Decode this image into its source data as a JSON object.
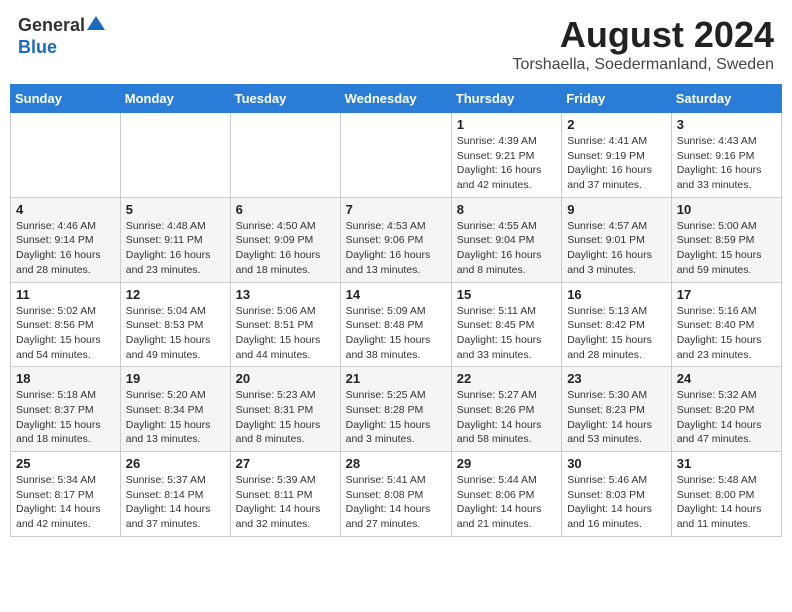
{
  "header": {
    "logo_general": "General",
    "logo_blue": "Blue",
    "title": "August 2024",
    "location": "Torshaella, Soedermanland, Sweden"
  },
  "days_of_week": [
    "Sunday",
    "Monday",
    "Tuesday",
    "Wednesday",
    "Thursday",
    "Friday",
    "Saturday"
  ],
  "weeks": [
    [
      {
        "day": "",
        "info": ""
      },
      {
        "day": "",
        "info": ""
      },
      {
        "day": "",
        "info": ""
      },
      {
        "day": "",
        "info": ""
      },
      {
        "day": "1",
        "info": "Sunrise: 4:39 AM\nSunset: 9:21 PM\nDaylight: 16 hours\nand 42 minutes."
      },
      {
        "day": "2",
        "info": "Sunrise: 4:41 AM\nSunset: 9:19 PM\nDaylight: 16 hours\nand 37 minutes."
      },
      {
        "day": "3",
        "info": "Sunrise: 4:43 AM\nSunset: 9:16 PM\nDaylight: 16 hours\nand 33 minutes."
      }
    ],
    [
      {
        "day": "4",
        "info": "Sunrise: 4:46 AM\nSunset: 9:14 PM\nDaylight: 16 hours\nand 28 minutes."
      },
      {
        "day": "5",
        "info": "Sunrise: 4:48 AM\nSunset: 9:11 PM\nDaylight: 16 hours\nand 23 minutes."
      },
      {
        "day": "6",
        "info": "Sunrise: 4:50 AM\nSunset: 9:09 PM\nDaylight: 16 hours\nand 18 minutes."
      },
      {
        "day": "7",
        "info": "Sunrise: 4:53 AM\nSunset: 9:06 PM\nDaylight: 16 hours\nand 13 minutes."
      },
      {
        "day": "8",
        "info": "Sunrise: 4:55 AM\nSunset: 9:04 PM\nDaylight: 16 hours\nand 8 minutes."
      },
      {
        "day": "9",
        "info": "Sunrise: 4:57 AM\nSunset: 9:01 PM\nDaylight: 16 hours\nand 3 minutes."
      },
      {
        "day": "10",
        "info": "Sunrise: 5:00 AM\nSunset: 8:59 PM\nDaylight: 15 hours\nand 59 minutes."
      }
    ],
    [
      {
        "day": "11",
        "info": "Sunrise: 5:02 AM\nSunset: 8:56 PM\nDaylight: 15 hours\nand 54 minutes."
      },
      {
        "day": "12",
        "info": "Sunrise: 5:04 AM\nSunset: 8:53 PM\nDaylight: 15 hours\nand 49 minutes."
      },
      {
        "day": "13",
        "info": "Sunrise: 5:06 AM\nSunset: 8:51 PM\nDaylight: 15 hours\nand 44 minutes."
      },
      {
        "day": "14",
        "info": "Sunrise: 5:09 AM\nSunset: 8:48 PM\nDaylight: 15 hours\nand 38 minutes."
      },
      {
        "day": "15",
        "info": "Sunrise: 5:11 AM\nSunset: 8:45 PM\nDaylight: 15 hours\nand 33 minutes."
      },
      {
        "day": "16",
        "info": "Sunrise: 5:13 AM\nSunset: 8:42 PM\nDaylight: 15 hours\nand 28 minutes."
      },
      {
        "day": "17",
        "info": "Sunrise: 5:16 AM\nSunset: 8:40 PM\nDaylight: 15 hours\nand 23 minutes."
      }
    ],
    [
      {
        "day": "18",
        "info": "Sunrise: 5:18 AM\nSunset: 8:37 PM\nDaylight: 15 hours\nand 18 minutes."
      },
      {
        "day": "19",
        "info": "Sunrise: 5:20 AM\nSunset: 8:34 PM\nDaylight: 15 hours\nand 13 minutes."
      },
      {
        "day": "20",
        "info": "Sunrise: 5:23 AM\nSunset: 8:31 PM\nDaylight: 15 hours\nand 8 minutes."
      },
      {
        "day": "21",
        "info": "Sunrise: 5:25 AM\nSunset: 8:28 PM\nDaylight: 15 hours\nand 3 minutes."
      },
      {
        "day": "22",
        "info": "Sunrise: 5:27 AM\nSunset: 8:26 PM\nDaylight: 14 hours\nand 58 minutes."
      },
      {
        "day": "23",
        "info": "Sunrise: 5:30 AM\nSunset: 8:23 PM\nDaylight: 14 hours\nand 53 minutes."
      },
      {
        "day": "24",
        "info": "Sunrise: 5:32 AM\nSunset: 8:20 PM\nDaylight: 14 hours\nand 47 minutes."
      }
    ],
    [
      {
        "day": "25",
        "info": "Sunrise: 5:34 AM\nSunset: 8:17 PM\nDaylight: 14 hours\nand 42 minutes."
      },
      {
        "day": "26",
        "info": "Sunrise: 5:37 AM\nSunset: 8:14 PM\nDaylight: 14 hours\nand 37 minutes."
      },
      {
        "day": "27",
        "info": "Sunrise: 5:39 AM\nSunset: 8:11 PM\nDaylight: 14 hours\nand 32 minutes."
      },
      {
        "day": "28",
        "info": "Sunrise: 5:41 AM\nSunset: 8:08 PM\nDaylight: 14 hours\nand 27 minutes."
      },
      {
        "day": "29",
        "info": "Sunrise: 5:44 AM\nSunset: 8:06 PM\nDaylight: 14 hours\nand 21 minutes."
      },
      {
        "day": "30",
        "info": "Sunrise: 5:46 AM\nSunset: 8:03 PM\nDaylight: 14 hours\nand 16 minutes."
      },
      {
        "day": "31",
        "info": "Sunrise: 5:48 AM\nSunset: 8:00 PM\nDaylight: 14 hours\nand 11 minutes."
      }
    ]
  ]
}
